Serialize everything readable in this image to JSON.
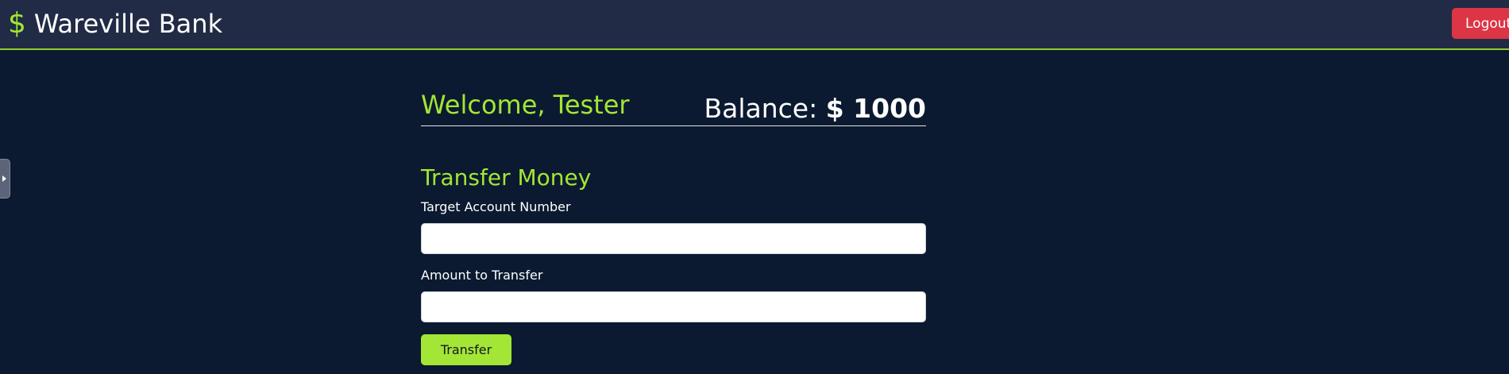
{
  "navbar": {
    "brand_icon": "$",
    "brand_name": "Wareville Bank",
    "logout_label": "Logout"
  },
  "welcome": {
    "greeting": "Welcome, Tester",
    "balance_label": "Balance:",
    "balance_value": "$ 1000"
  },
  "transfer": {
    "title": "Transfer Money",
    "target_label": "Target Account Number",
    "target_value": "",
    "amount_label": "Amount to Transfer",
    "amount_value": "",
    "button_label": "Transfer"
  },
  "colors": {
    "background": "#0b1a30",
    "navbar": "#212b45",
    "accent": "#a3e635",
    "danger": "#dc3545"
  },
  "icons": {
    "brand": "dollar-icon",
    "side_tab": "play-arrow-icon"
  }
}
